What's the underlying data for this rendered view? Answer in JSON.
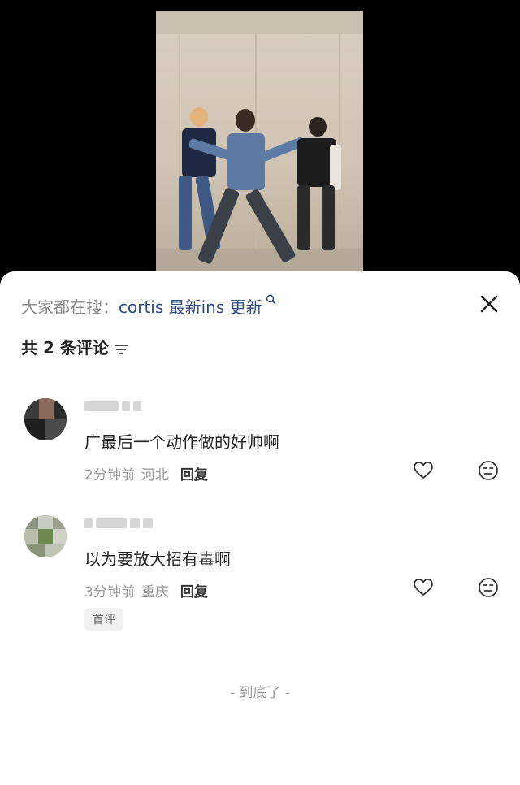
{
  "search": {
    "prefix": "大家都在搜：",
    "keyword": "cortis 最新ins 更新",
    "icon": "search-icon"
  },
  "header": {
    "count_label": "共 2 条评论",
    "sort_icon": "sort-icon",
    "close_icon": "close-icon"
  },
  "comments": [
    {
      "text": "广最后一个动作做的好帅啊",
      "time": "2分钟前",
      "location": "河北",
      "reply": "回复"
    },
    {
      "text": "以为要放大招有毒啊",
      "time": "3分钟前",
      "location": "重庆",
      "reply": "回复",
      "badge": "首评"
    }
  ],
  "footer": {
    "end_text": "- 到底了 -"
  },
  "colors": {
    "keyword": "#2d4a7a",
    "muted": "#999999",
    "text": "#222222",
    "background": "#ffffff"
  }
}
